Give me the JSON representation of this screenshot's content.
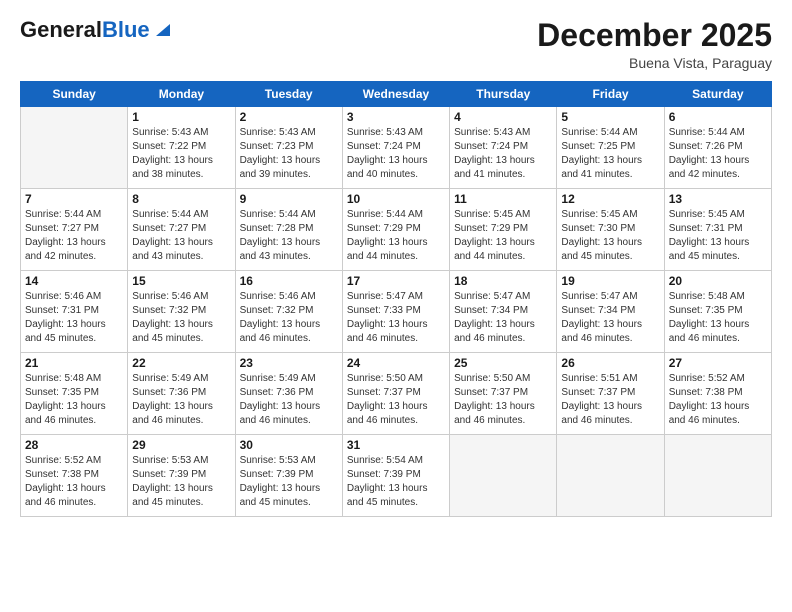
{
  "header": {
    "logo_line1": "General",
    "logo_line2": "Blue",
    "month": "December 2025",
    "location": "Buena Vista, Paraguay"
  },
  "days_of_week": [
    "Sunday",
    "Monday",
    "Tuesday",
    "Wednesday",
    "Thursday",
    "Friday",
    "Saturday"
  ],
  "weeks": [
    [
      {
        "day": "",
        "info": ""
      },
      {
        "day": "1",
        "info": "Sunrise: 5:43 AM\nSunset: 7:22 PM\nDaylight: 13 hours\nand 38 minutes."
      },
      {
        "day": "2",
        "info": "Sunrise: 5:43 AM\nSunset: 7:23 PM\nDaylight: 13 hours\nand 39 minutes."
      },
      {
        "day": "3",
        "info": "Sunrise: 5:43 AM\nSunset: 7:24 PM\nDaylight: 13 hours\nand 40 minutes."
      },
      {
        "day": "4",
        "info": "Sunrise: 5:43 AM\nSunset: 7:24 PM\nDaylight: 13 hours\nand 41 minutes."
      },
      {
        "day": "5",
        "info": "Sunrise: 5:44 AM\nSunset: 7:25 PM\nDaylight: 13 hours\nand 41 minutes."
      },
      {
        "day": "6",
        "info": "Sunrise: 5:44 AM\nSunset: 7:26 PM\nDaylight: 13 hours\nand 42 minutes."
      }
    ],
    [
      {
        "day": "7",
        "info": "Sunrise: 5:44 AM\nSunset: 7:27 PM\nDaylight: 13 hours\nand 42 minutes."
      },
      {
        "day": "8",
        "info": "Sunrise: 5:44 AM\nSunset: 7:27 PM\nDaylight: 13 hours\nand 43 minutes."
      },
      {
        "day": "9",
        "info": "Sunrise: 5:44 AM\nSunset: 7:28 PM\nDaylight: 13 hours\nand 43 minutes."
      },
      {
        "day": "10",
        "info": "Sunrise: 5:44 AM\nSunset: 7:29 PM\nDaylight: 13 hours\nand 44 minutes."
      },
      {
        "day": "11",
        "info": "Sunrise: 5:45 AM\nSunset: 7:29 PM\nDaylight: 13 hours\nand 44 minutes."
      },
      {
        "day": "12",
        "info": "Sunrise: 5:45 AM\nSunset: 7:30 PM\nDaylight: 13 hours\nand 45 minutes."
      },
      {
        "day": "13",
        "info": "Sunrise: 5:45 AM\nSunset: 7:31 PM\nDaylight: 13 hours\nand 45 minutes."
      }
    ],
    [
      {
        "day": "14",
        "info": "Sunrise: 5:46 AM\nSunset: 7:31 PM\nDaylight: 13 hours\nand 45 minutes."
      },
      {
        "day": "15",
        "info": "Sunrise: 5:46 AM\nSunset: 7:32 PM\nDaylight: 13 hours\nand 45 minutes."
      },
      {
        "day": "16",
        "info": "Sunrise: 5:46 AM\nSunset: 7:32 PM\nDaylight: 13 hours\nand 46 minutes."
      },
      {
        "day": "17",
        "info": "Sunrise: 5:47 AM\nSunset: 7:33 PM\nDaylight: 13 hours\nand 46 minutes."
      },
      {
        "day": "18",
        "info": "Sunrise: 5:47 AM\nSunset: 7:34 PM\nDaylight: 13 hours\nand 46 minutes."
      },
      {
        "day": "19",
        "info": "Sunrise: 5:47 AM\nSunset: 7:34 PM\nDaylight: 13 hours\nand 46 minutes."
      },
      {
        "day": "20",
        "info": "Sunrise: 5:48 AM\nSunset: 7:35 PM\nDaylight: 13 hours\nand 46 minutes."
      }
    ],
    [
      {
        "day": "21",
        "info": "Sunrise: 5:48 AM\nSunset: 7:35 PM\nDaylight: 13 hours\nand 46 minutes."
      },
      {
        "day": "22",
        "info": "Sunrise: 5:49 AM\nSunset: 7:36 PM\nDaylight: 13 hours\nand 46 minutes."
      },
      {
        "day": "23",
        "info": "Sunrise: 5:49 AM\nSunset: 7:36 PM\nDaylight: 13 hours\nand 46 minutes."
      },
      {
        "day": "24",
        "info": "Sunrise: 5:50 AM\nSunset: 7:37 PM\nDaylight: 13 hours\nand 46 minutes."
      },
      {
        "day": "25",
        "info": "Sunrise: 5:50 AM\nSunset: 7:37 PM\nDaylight: 13 hours\nand 46 minutes."
      },
      {
        "day": "26",
        "info": "Sunrise: 5:51 AM\nSunset: 7:37 PM\nDaylight: 13 hours\nand 46 minutes."
      },
      {
        "day": "27",
        "info": "Sunrise: 5:52 AM\nSunset: 7:38 PM\nDaylight: 13 hours\nand 46 minutes."
      }
    ],
    [
      {
        "day": "28",
        "info": "Sunrise: 5:52 AM\nSunset: 7:38 PM\nDaylight: 13 hours\nand 46 minutes."
      },
      {
        "day": "29",
        "info": "Sunrise: 5:53 AM\nSunset: 7:39 PM\nDaylight: 13 hours\nand 45 minutes."
      },
      {
        "day": "30",
        "info": "Sunrise: 5:53 AM\nSunset: 7:39 PM\nDaylight: 13 hours\nand 45 minutes."
      },
      {
        "day": "31",
        "info": "Sunrise: 5:54 AM\nSunset: 7:39 PM\nDaylight: 13 hours\nand 45 minutes."
      },
      {
        "day": "",
        "info": ""
      },
      {
        "day": "",
        "info": ""
      },
      {
        "day": "",
        "info": ""
      }
    ]
  ]
}
